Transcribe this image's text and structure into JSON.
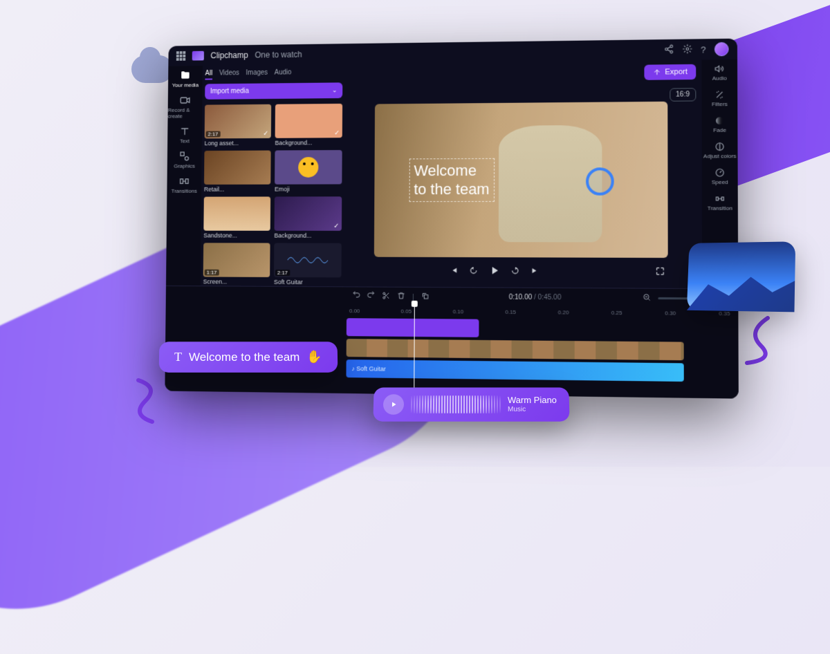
{
  "app": {
    "name": "Clipchamp",
    "project": "One to watch"
  },
  "header": {
    "export_label": "Export",
    "aspect_ratio": "16:9"
  },
  "leftnav": {
    "items": [
      {
        "label": "Your media",
        "icon": "folder-icon"
      },
      {
        "label": "Record & create",
        "icon": "camera-icon"
      },
      {
        "label": "Text",
        "icon": "text-icon"
      },
      {
        "label": "Graphics",
        "icon": "graphics-icon"
      },
      {
        "label": "Transitions",
        "icon": "transitions-icon"
      }
    ]
  },
  "media_panel": {
    "tabs": [
      "All",
      "Videos",
      "Images",
      "Audio"
    ],
    "active_tab": "All",
    "import_label": "Import media",
    "items": [
      {
        "label": "Long asset...",
        "duration": "2:17",
        "checked": true
      },
      {
        "label": "Background...",
        "checked": true
      },
      {
        "label": "Retail...",
        "checked": false
      },
      {
        "label": "Emoji",
        "checked": false
      },
      {
        "label": "Sandstone...",
        "checked": false
      },
      {
        "label": "Background...",
        "checked": true
      },
      {
        "label": "Screen...",
        "duration": "1:17",
        "checked": false
      },
      {
        "label": "Soft Guitar",
        "duration": "2:17",
        "checked": false
      }
    ]
  },
  "preview": {
    "overlay_text_line1": "Welcome",
    "overlay_text_line2": "to the team"
  },
  "playback": {
    "current_time": "0:10.00",
    "total_time": "0:45.00"
  },
  "righttool": {
    "items": [
      {
        "label": "Audio",
        "icon": "speaker-icon"
      },
      {
        "label": "Filters",
        "icon": "sparkle-icon"
      },
      {
        "label": "Fade",
        "icon": "fade-icon"
      },
      {
        "label": "Adjust colors",
        "icon": "contrast-icon"
      },
      {
        "label": "Speed",
        "icon": "speed-icon"
      },
      {
        "label": "Transition",
        "icon": "transition-icon"
      }
    ]
  },
  "timeline": {
    "ruler": [
      "0.00",
      "0.05",
      "0.10",
      "0.15",
      "0.20",
      "0.25",
      "0.30",
      "0.35"
    ],
    "audio_clip_label": "Soft Guitar"
  },
  "chips": {
    "title_text": "Welcome to the team",
    "music_name": "Warm Piano",
    "music_category": "Music"
  },
  "colors": {
    "accent": "#7c3aed",
    "bg_dark": "#0d0d1f",
    "audio_track": "#2563eb"
  }
}
